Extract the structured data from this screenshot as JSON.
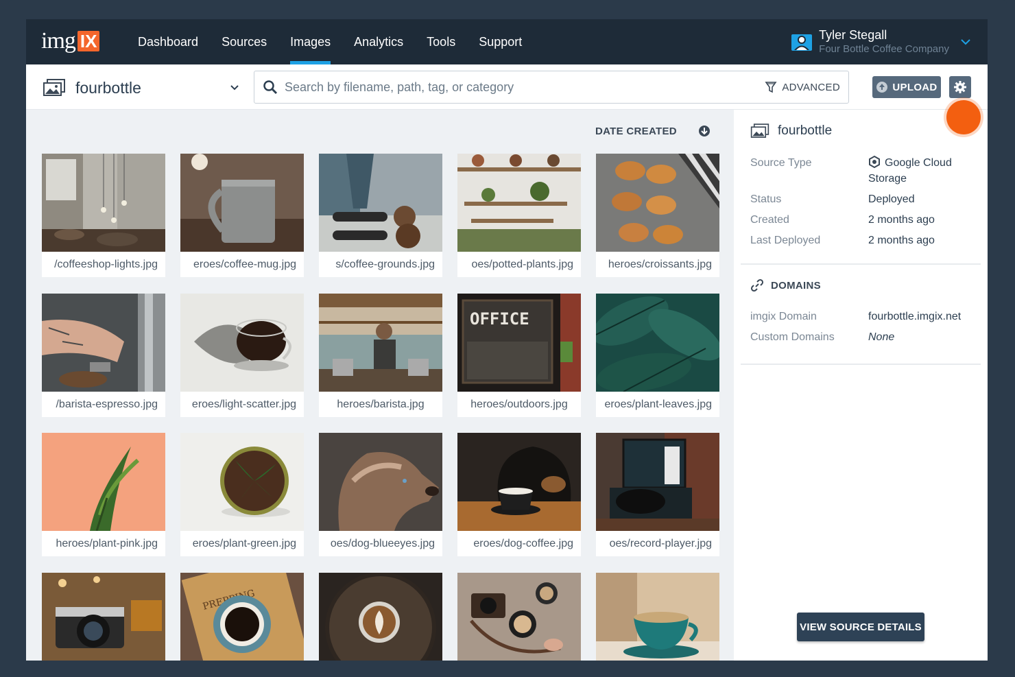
{
  "nav": {
    "logo_text": "img",
    "logo_box": "IX",
    "items": [
      {
        "label": "Dashboard",
        "active": false
      },
      {
        "label": "Sources",
        "active": false
      },
      {
        "label": "Images",
        "active": true
      },
      {
        "label": "Analytics",
        "active": false
      },
      {
        "label": "Tools",
        "active": false
      },
      {
        "label": "Support",
        "active": false
      }
    ],
    "user": {
      "name": "Tyler Stegall",
      "company": "Four Bottle Coffee Company"
    }
  },
  "toolbar": {
    "source": "fourbottle",
    "search_placeholder": "Search by filename, path, tag, or category",
    "advanced_label": "ADVANCED",
    "upload_label": "UPLOAD"
  },
  "sort": {
    "label": "DATE CREATED"
  },
  "images": [
    {
      "name": "/coffeeshop-lights.jpg",
      "scene": "interior"
    },
    {
      "name": "eroes/coffee-mug.jpg",
      "scene": "mug"
    },
    {
      "name": "s/coffee-grounds.jpg",
      "scene": "grounds"
    },
    {
      "name": "oes/potted-plants.jpg",
      "scene": "shelves"
    },
    {
      "name": "heroes/croissants.jpg",
      "scene": "croissants"
    },
    {
      "name": "/barista-espresso.jpg",
      "scene": "espresso"
    },
    {
      "name": "eroes/light-scatter.jpg",
      "scene": "glass"
    },
    {
      "name": "heroes/barista.jpg",
      "scene": "barista"
    },
    {
      "name": "heroes/outdoors.jpg",
      "scene": "office"
    },
    {
      "name": "eroes/plant-leaves.jpg",
      "scene": "leaves"
    },
    {
      "name": "heroes/plant-pink.jpg",
      "scene": "pinkplant"
    },
    {
      "name": "eroes/plant-green.jpg",
      "scene": "greenplant"
    },
    {
      "name": "oes/dog-blueeyes.jpg",
      "scene": "dog"
    },
    {
      "name": "eroes/dog-coffee.jpg",
      "scene": "dogcoffee"
    },
    {
      "name": "oes/record-player.jpg",
      "scene": "record"
    },
    {
      "name": "",
      "scene": "camera"
    },
    {
      "name": "",
      "scene": "prepping"
    },
    {
      "name": "",
      "scene": "latte"
    },
    {
      "name": "",
      "scene": "cameras2"
    },
    {
      "name": "",
      "scene": "tealcup"
    }
  ],
  "panel": {
    "title": "fourbottle",
    "props": [
      {
        "key": "Source Type",
        "value": "Google Cloud Storage"
      },
      {
        "key": "Status",
        "value": "Deployed"
      },
      {
        "key": "Created",
        "value": "2 months ago"
      },
      {
        "key": "Last Deployed",
        "value": "2 months ago"
      }
    ],
    "domains_heading": "DOMAINS",
    "domains": [
      {
        "key": "imgix Domain",
        "value": "fourbottle.imgix.net"
      },
      {
        "key": "Custom Domains",
        "value": "None"
      }
    ],
    "view_button": "VIEW SOURCE DETAILS"
  },
  "colors": {
    "accent": "#1ea1e4",
    "brand": "#f4662c",
    "nav_bg": "#1e2b38",
    "button": "#56697c"
  }
}
